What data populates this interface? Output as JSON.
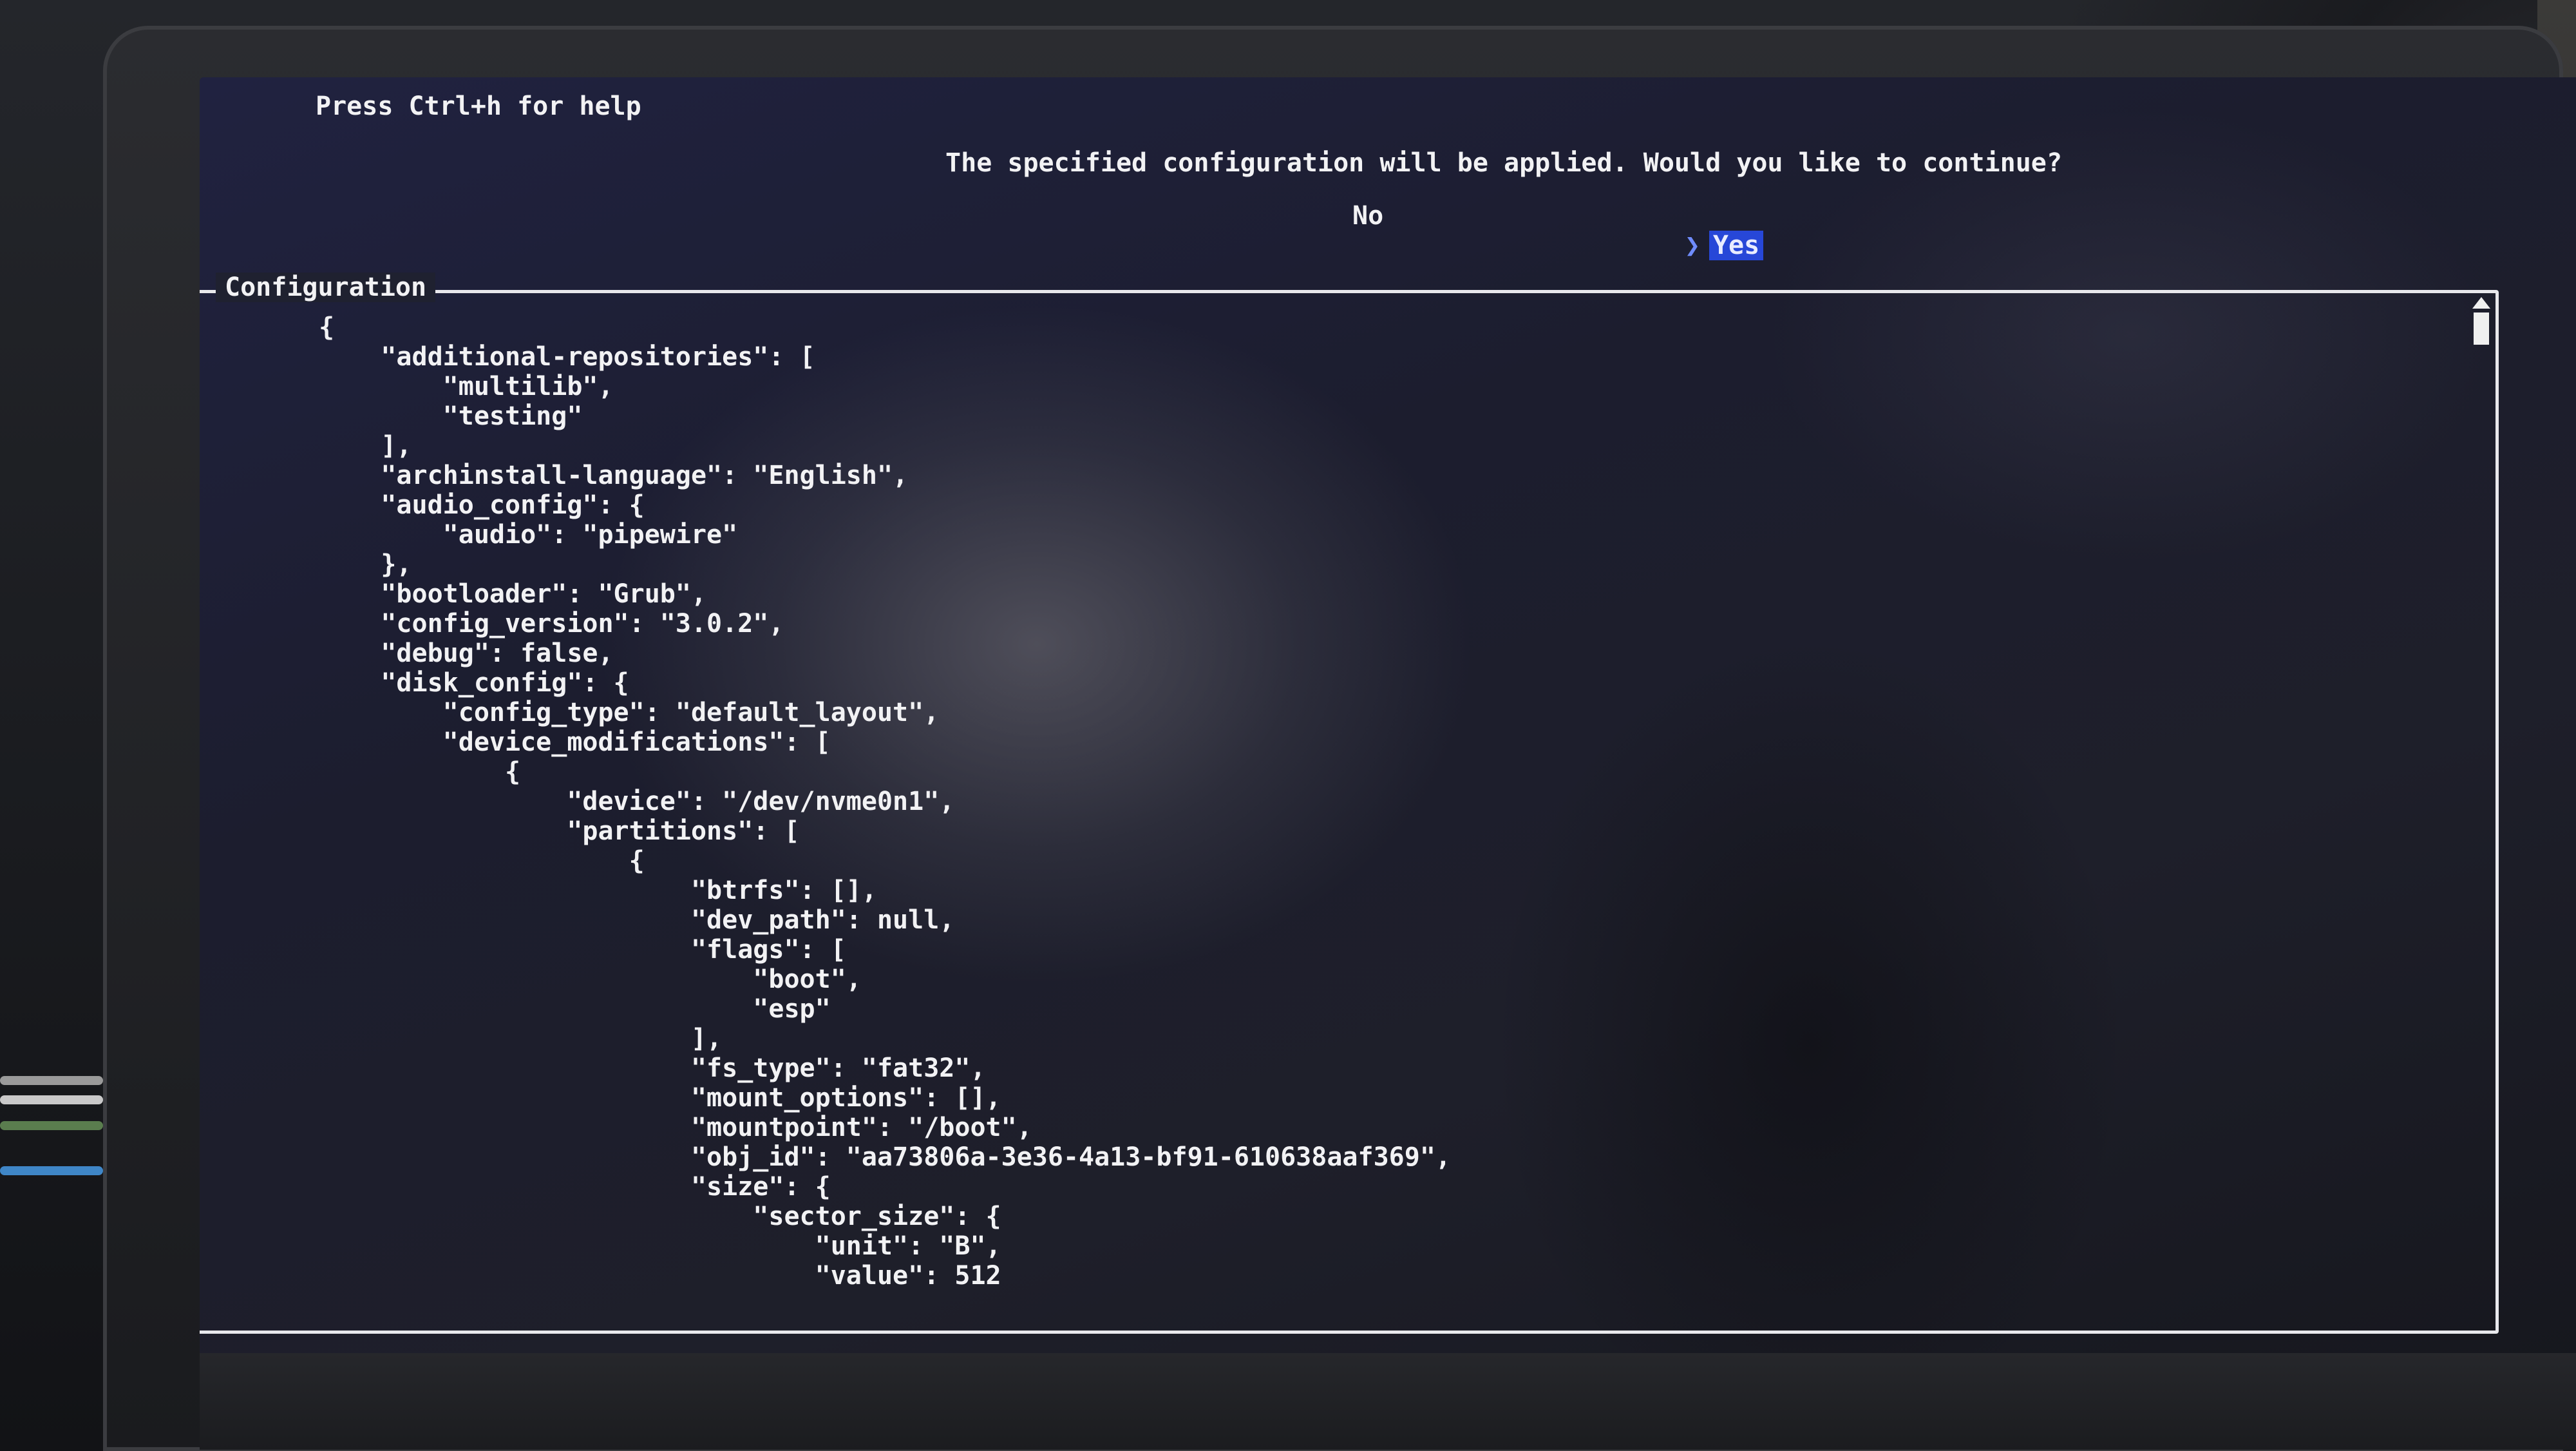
{
  "terminal": {
    "help_text": "Press Ctrl+h for help",
    "prompt": "The specified configuration will be applied. Would you like to continue?",
    "options": {
      "no": "No",
      "yes": "Yes",
      "selected": "Yes"
    }
  },
  "config_panel": {
    "title": "Configuration",
    "lines": [
      "{",
      "    \"additional-repositories\": [",
      "        \"multilib\",",
      "        \"testing\"",
      "    ],",
      "    \"archinstall-language\": \"English\",",
      "    \"audio_config\": {",
      "        \"audio\": \"pipewire\"",
      "    },",
      "    \"bootloader\": \"Grub\",",
      "    \"config_version\": \"3.0.2\",",
      "    \"debug\": false,",
      "    \"disk_config\": {",
      "        \"config_type\": \"default_layout\",",
      "        \"device_modifications\": [",
      "            {",
      "                \"device\": \"/dev/nvme0n1\",",
      "                \"partitions\": [",
      "                    {",
      "                        \"btrfs\": [],",
      "                        \"dev_path\": null,",
      "                        \"flags\": [",
      "                            \"boot\",",
      "                            \"esp\"",
      "                        ],",
      "                        \"fs_type\": \"fat32\",",
      "                        \"mount_options\": [],",
      "                        \"mountpoint\": \"/boot\",",
      "                        \"obj_id\": \"aa73806a-3e36-4a13-bf91-610638aaf369\",",
      "                        \"size\": {",
      "                            \"sector_size\": {",
      "                                \"unit\": \"B\",",
      "                                \"value\": 512"
    ]
  },
  "colors": {
    "screen_bg": "#1f2130",
    "text": "#f2f2f4",
    "selection_bg": "#2747d8",
    "cursor": "#6f8cff",
    "border": "#e8e8ec"
  }
}
